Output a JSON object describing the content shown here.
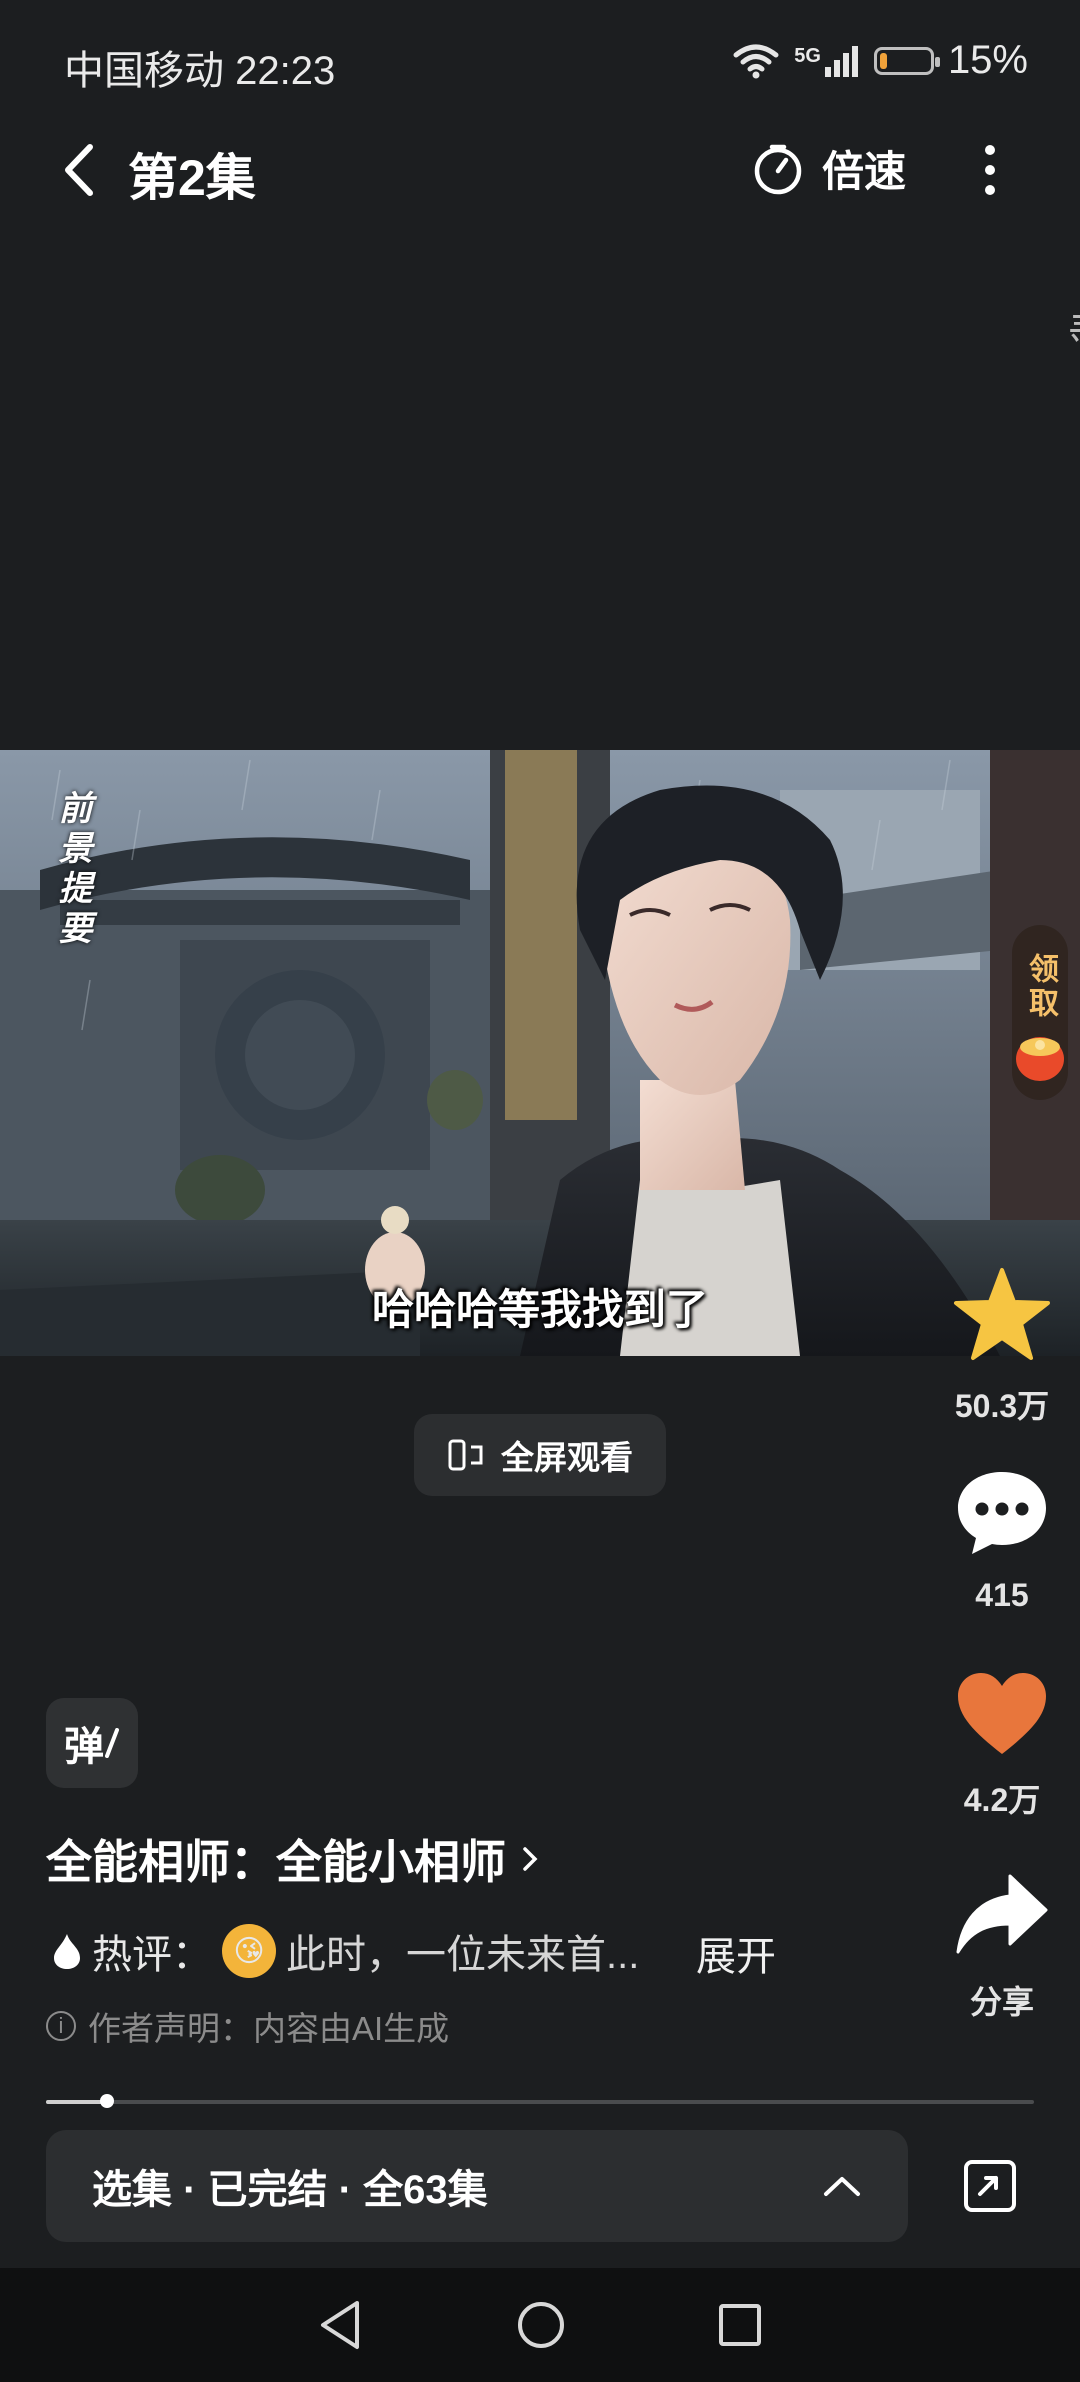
{
  "status": {
    "carrier_time": "中国移动 22:23",
    "network": "5G",
    "battery": "15%",
    "battery_level": 0.15
  },
  "header": {
    "title": "第2集",
    "speed_label": "倍速"
  },
  "edge_glyph": "剥",
  "video": {
    "subtitle": "哈哈哈等我找到了",
    "recap_label": "前景提要",
    "claim_label": "领取"
  },
  "fullscreen_label": "全屏观看",
  "actions": {
    "favorite_count": "50.3万",
    "comment_count": "415",
    "like_count": "4.2万",
    "share_label": "分享"
  },
  "danmaku_label": "弹",
  "series": {
    "title": "全能相师：全能小相师"
  },
  "hot_comment": {
    "label": "热评：",
    "text": "此时，一位未来首...",
    "expand": "展开"
  },
  "disclaimer": "作者声明：内容由AI生成",
  "playback_progress": 0.062,
  "episode_bar": {
    "label": "选集 · 已完结 · 全63集"
  },
  "colors": {
    "background": "#1c1e20",
    "star": "#f6c542",
    "heart": "#e8763c",
    "accent_gold": "#f5c06a"
  }
}
